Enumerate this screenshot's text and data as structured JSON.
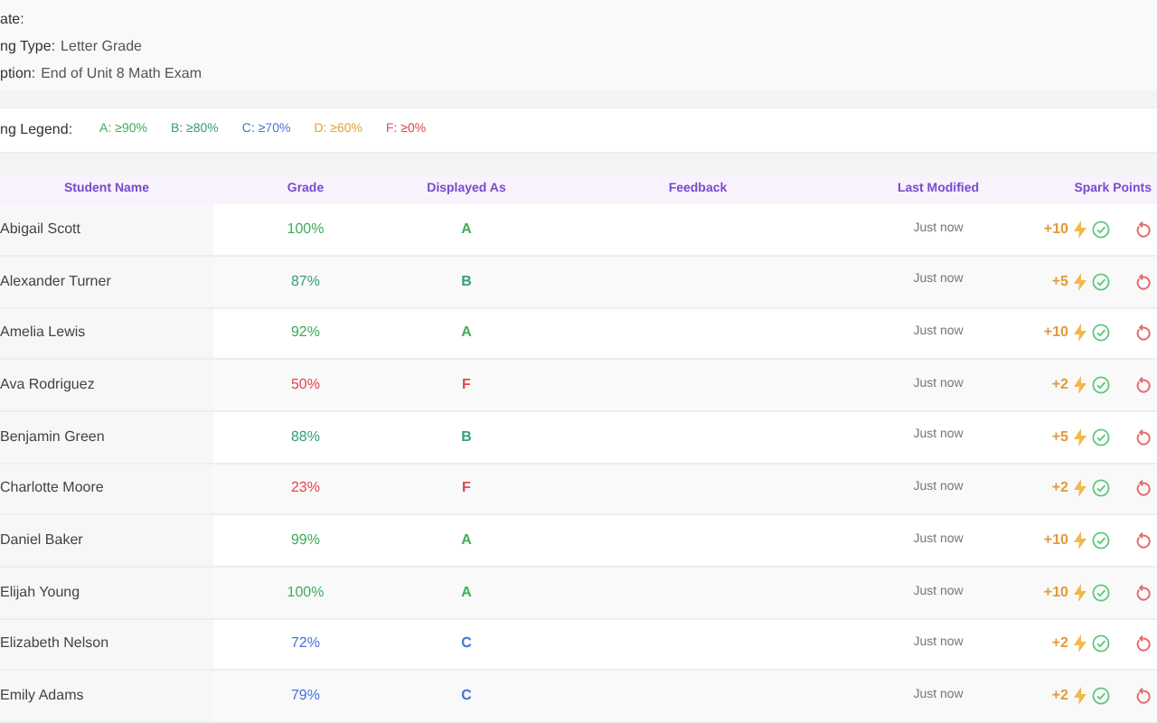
{
  "info": [
    {
      "label": "ate:"
    },
    {
      "label": "ng Type:",
      "value": "Letter Grade"
    },
    {
      "label": "ption:",
      "value": "End of Unit 8 Math Exam"
    }
  ],
  "legend": {
    "label": "ng Legend:",
    "items": [
      {
        "text": "A: ≥90%",
        "color": "#3fae5a"
      },
      {
        "text": "B: ≥80%",
        "color": "#3a9f7a"
      },
      {
        "text": "C: ≥70%",
        "color": "#4a76d6"
      },
      {
        "text": "D: ≥60%",
        "color": "#e0a43a"
      },
      {
        "text": "F: ≥0%",
        "color": "#e0484e"
      }
    ]
  },
  "table": {
    "columns": [
      "Student Name",
      "Grade",
      "Displayed As",
      "Feedback",
      "Last Modified",
      "Spark Points"
    ],
    "rows": [
      {
        "name": "Abigail Scott",
        "grade": "100%",
        "displayed": "A",
        "color": "#3fae5a",
        "modified": "Just now",
        "points": "+10"
      },
      {
        "name": "Alexander Turner",
        "grade": "87%",
        "displayed": "B",
        "color": "#3a9f7a",
        "modified": "Just now",
        "points": "+5"
      },
      {
        "name": "Amelia Lewis",
        "grade": "92%",
        "displayed": "A",
        "color": "#3fae5a",
        "modified": "Just now",
        "points": "+10"
      },
      {
        "name": "Ava Rodriguez",
        "grade": "50%",
        "displayed": "F",
        "color": "#e0484e",
        "modified": "Just now",
        "points": "+2"
      },
      {
        "name": "Benjamin Green",
        "grade": "88%",
        "displayed": "B",
        "color": "#3a9f7a",
        "modified": "Just now",
        "points": "+5"
      },
      {
        "name": "Charlotte Moore",
        "grade": "23%",
        "displayed": "F",
        "color": "#e0484e",
        "modified": "Just now",
        "points": "+2"
      },
      {
        "name": "Daniel Baker",
        "grade": "99%",
        "displayed": "A",
        "color": "#3fae5a",
        "modified": "Just now",
        "points": "+10"
      },
      {
        "name": "Elijah Young",
        "grade": "100%",
        "displayed": "A",
        "color": "#3fae5a",
        "modified": "Just now",
        "points": "+10"
      },
      {
        "name": "Elizabeth Nelson",
        "grade": "72%",
        "displayed": "C",
        "color": "#4a76d6",
        "modified": "Just now",
        "points": "+2"
      },
      {
        "name": "Emily Adams",
        "grade": "79%",
        "displayed": "C",
        "color": "#4a76d6",
        "modified": "Just now",
        "points": "+2"
      }
    ]
  }
}
